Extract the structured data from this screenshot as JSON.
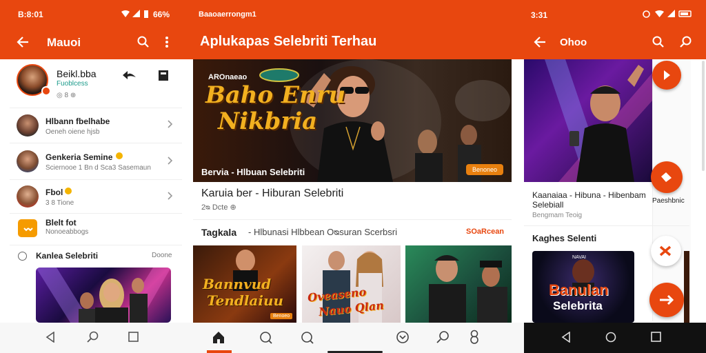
{
  "colors": {
    "accent": "#e8470f",
    "accent_dark": "#c8380a"
  },
  "left": {
    "status_time": "B:8:01",
    "status_right": "66%",
    "title": "Mauoi",
    "profile": {
      "name": "Beikl.bba",
      "tag": "Fuoblcess",
      "meta": "◎ 8 ⊕"
    },
    "rows": [
      {
        "title": "Hlbann fbelhabe",
        "sub": "Oeneh oiene hjsb"
      },
      {
        "title": "Genkeria Semine",
        "sub": "Sciernooe 1 Bn d Sca3 Sasemaun"
      },
      {
        "title": "Fbol",
        "sub": "3 8 Tione"
      },
      {
        "title": "Blelt fot",
        "sub": "Nonoeabbogs"
      }
    ],
    "section": {
      "label": "Kanlea Selebriti",
      "action": "Doone"
    }
  },
  "center": {
    "status_text": "Baaoaerrongm1",
    "title": "Aplukapas Selebriti Terhau",
    "hero": {
      "logo_top": "AROnaeao",
      "logo_big_1": "Baho Enru",
      "logo_big_2": "Nikbria",
      "caption": "Bervia - Hlbuan Selebriti",
      "badge": "Benoneo"
    },
    "card_title": "Karuia ber - Hiburan Selebriti",
    "card_meta": "2ᴓ Dcte ⊕",
    "section_left": "Tagkala",
    "section_mid": "- Hlbunasi Hlbbean Oᴓsuran Scerbsri",
    "section_action": "SOaRcean",
    "thumbs": [
      {
        "text_1": "Bannvud",
        "text_2": "Tendlaiuu",
        "badge": "Benoeo"
      },
      {
        "text_1": "Oveaseno",
        "text_2": "Nauo Qlan",
        "badge": ""
      },
      {
        "text_1": "",
        "text_2": "",
        "badge": ""
      }
    ]
  },
  "right": {
    "status_time": "3:31",
    "title": "Ohoo",
    "card_title": "Kaanaiaa - Hibuna - Hibenbam Selebiall",
    "card_extra": "Paeshbnic",
    "card_sub": "Bengmam Teoig",
    "section": "Kaghes Selenti",
    "thumb_text_1": "Banulan",
    "thumb_text_2": "Selebrita",
    "thumb_small": "NAVAI"
  }
}
